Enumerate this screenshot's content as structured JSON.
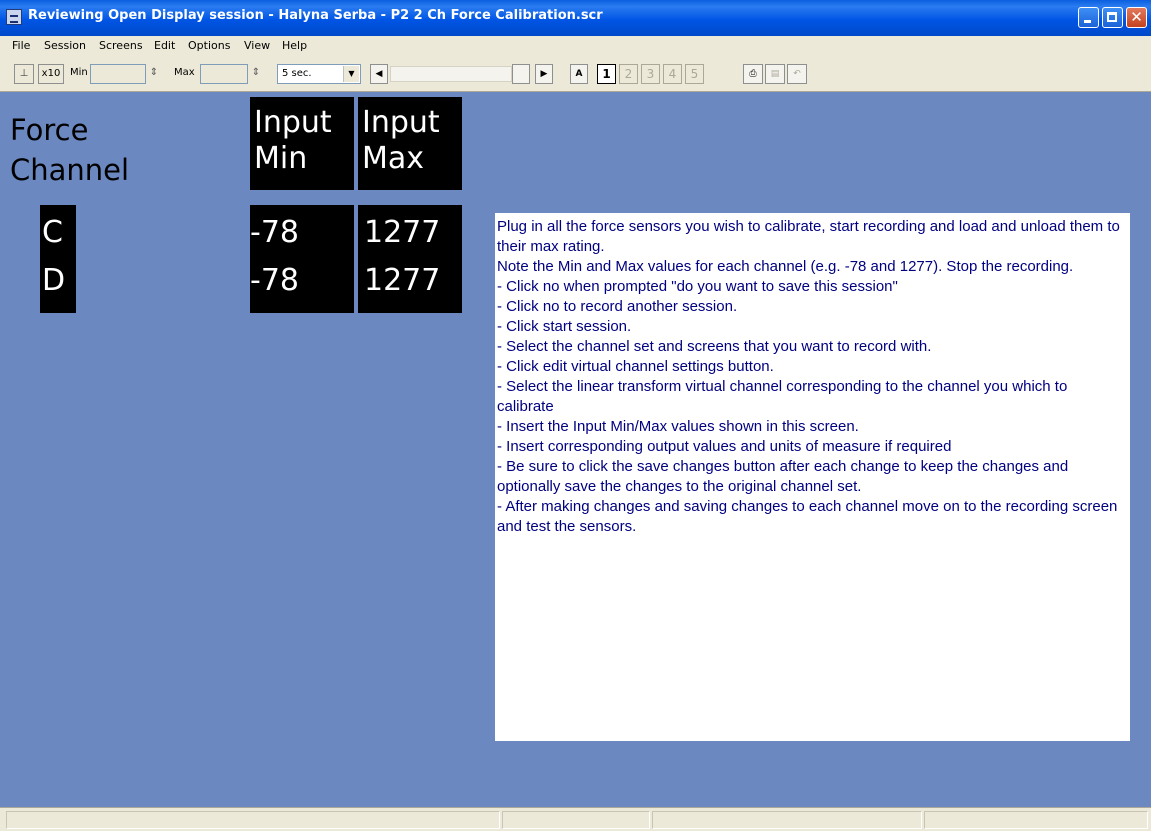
{
  "window": {
    "title": "Reviewing Open Display session - Halyna Serba - P2 2 Ch Force Calibration.scr"
  },
  "menu": [
    "File",
    "Session",
    "Screens",
    "Edit",
    "Options",
    "View",
    "Help"
  ],
  "toolbar": {
    "zoom_label": "x10",
    "min_label": "Min",
    "min_value": "",
    "max_label": "Max",
    "max_value": "",
    "timebase": "5 sec.",
    "font_button": "A",
    "screen_buttons": [
      "1",
      "2",
      "3",
      "4",
      "5"
    ],
    "active_screen": "1"
  },
  "table": {
    "heading_line1": "Force",
    "heading_line2": "Channel",
    "col_min_line1": "Input",
    "col_min_line2": "Min",
    "col_max_line1": "Input",
    "col_max_line2": "Max",
    "rows": [
      {
        "channel": "C",
        "min": "-78",
        "max": "1277"
      },
      {
        "channel": "D",
        "min": "-78",
        "max": "1277"
      }
    ]
  },
  "instructions": [
    "Plug in all the force sensors you wish to calibrate, start recording and load and unload them to their max rating.",
    "",
    "Note the Min and Max values for each channel (e.g. -78 and 1277). Stop the recording.",
    "",
    "- Click no when prompted \"do you want to save this session\"",
    "- Click no to record another session.",
    "",
    "- Click start session.",
    "- Select the channel set and screens that you want to record with.",
    "- Click edit virtual channel settings button.",
    "- Select the linear transform virtual channel corresponding to the channel you which to calibrate",
    "- Insert the Input Min/Max values shown in this screen.",
    "- Insert corresponding output values and units of measure if required",
    "- Be sure to click the save changes button after each change to keep the changes and optionally save the changes to the original channel set.",
    "- After making changes and saving changes to each channel move on to the recording screen and test the sensors."
  ],
  "colors": {
    "workspace": "#6b88c0",
    "instruction_text": "#000080"
  }
}
